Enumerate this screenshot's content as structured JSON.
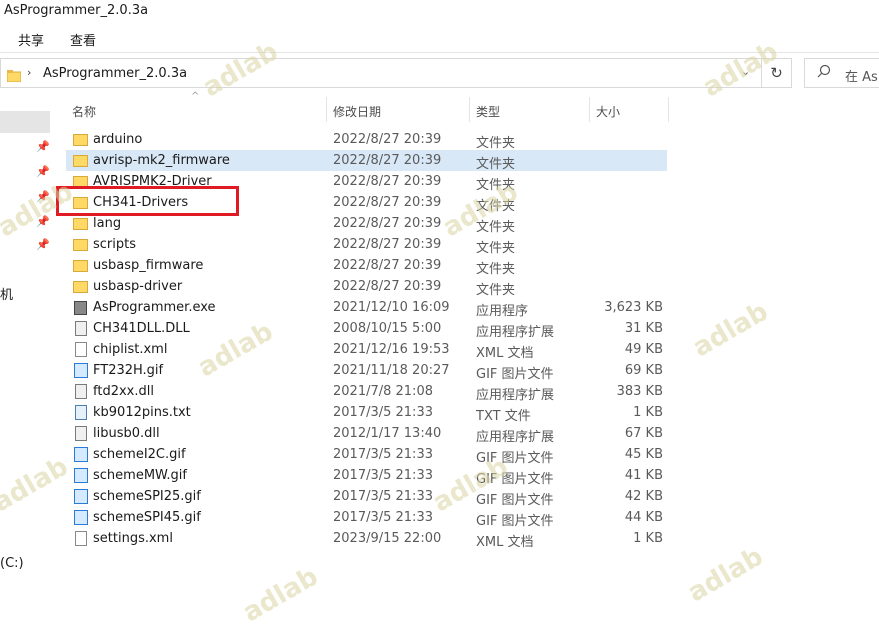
{
  "window": {
    "title": "AsProgrammer_2.0.3a"
  },
  "ribbon": {
    "tabs": [
      "共享",
      "查看"
    ]
  },
  "address": {
    "path": "AsProgrammer_2.0.3a",
    "search_placeholder": "在 AsP"
  },
  "nav": {
    "label_1": "机",
    "label_2": "(C:)"
  },
  "columns": {
    "name": "名称",
    "date": "修改日期",
    "type": "类型",
    "size": "大小"
  },
  "files": [
    {
      "name": "arduino",
      "date": "2022/8/27 20:39",
      "type": "文件夹",
      "size": "",
      "icon": "folder-icon"
    },
    {
      "name": "avrisp-mk2_firmware",
      "date": "2022/8/27 20:39",
      "type": "文件夹",
      "size": "",
      "icon": "folder-icon"
    },
    {
      "name": "AVRISPMK2-Driver",
      "date": "2022/8/27 20:39",
      "type": "文件夹",
      "size": "",
      "icon": "folder-icon"
    },
    {
      "name": "CH341-Drivers",
      "date": "2022/8/27 20:39",
      "type": "文件夹",
      "size": "",
      "icon": "folder-icon"
    },
    {
      "name": "lang",
      "date": "2022/8/27 20:39",
      "type": "文件夹",
      "size": "",
      "icon": "folder-icon"
    },
    {
      "name": "scripts",
      "date": "2022/8/27 20:39",
      "type": "文件夹",
      "size": "",
      "icon": "folder-icon"
    },
    {
      "name": "usbasp_firmware",
      "date": "2022/8/27 20:39",
      "type": "文件夹",
      "size": "",
      "icon": "folder-icon"
    },
    {
      "name": "usbasp-driver",
      "date": "2022/8/27 20:39",
      "type": "文件夹",
      "size": "",
      "icon": "folder-icon"
    },
    {
      "name": "AsProgrammer.exe",
      "date": "2021/12/10 16:09",
      "type": "应用程序",
      "size": "3,623 KB",
      "icon": "exe-icon"
    },
    {
      "name": "CH341DLL.DLL",
      "date": "2008/10/15 5:00",
      "type": "应用程序扩展",
      "size": "31 KB",
      "icon": "dll-icon"
    },
    {
      "name": "chiplist.xml",
      "date": "2021/12/16 19:53",
      "type": "XML 文档",
      "size": "49 KB",
      "icon": "document-icon"
    },
    {
      "name": "FT232H.gif",
      "date": "2021/11/18 20:27",
      "type": "GIF 图片文件",
      "size": "69 KB",
      "icon": "image-icon"
    },
    {
      "name": "ftd2xx.dll",
      "date": "2021/7/8 21:08",
      "type": "应用程序扩展",
      "size": "383 KB",
      "icon": "dll-icon"
    },
    {
      "name": "kb9012pins.txt",
      "date": "2017/3/5 21:33",
      "type": "TXT 文件",
      "size": "1 KB",
      "icon": "text-file-icon"
    },
    {
      "name": "libusb0.dll",
      "date": "2012/1/17 13:40",
      "type": "应用程序扩展",
      "size": "67 KB",
      "icon": "dll-icon"
    },
    {
      "name": "schemeI2C.gif",
      "date": "2017/3/5 21:33",
      "type": "GIF 图片文件",
      "size": "45 KB",
      "icon": "image-icon"
    },
    {
      "name": "schemeMW.gif",
      "date": "2017/3/5 21:33",
      "type": "GIF 图片文件",
      "size": "41 KB",
      "icon": "image-icon"
    },
    {
      "name": "schemeSPI25.gif",
      "date": "2017/3/5 21:33",
      "type": "GIF 图片文件",
      "size": "42 KB",
      "icon": "image-icon"
    },
    {
      "name": "schemeSPI45.gif",
      "date": "2017/3/5 21:33",
      "type": "GIF 图片文件",
      "size": "44 KB",
      "icon": "image-icon"
    },
    {
      "name": "settings.xml",
      "date": "2023/9/15 22:00",
      "type": "XML 文档",
      "size": "1 KB",
      "icon": "document-icon"
    }
  ],
  "selected_row": "avrisp-mk2_firmware",
  "highlighted_item": "CH341-Drivers",
  "watermark": "adlab",
  "colors": {
    "selection": "#d9e8f7",
    "highlight_border": "#e01b24",
    "folder": "#ffd966"
  }
}
